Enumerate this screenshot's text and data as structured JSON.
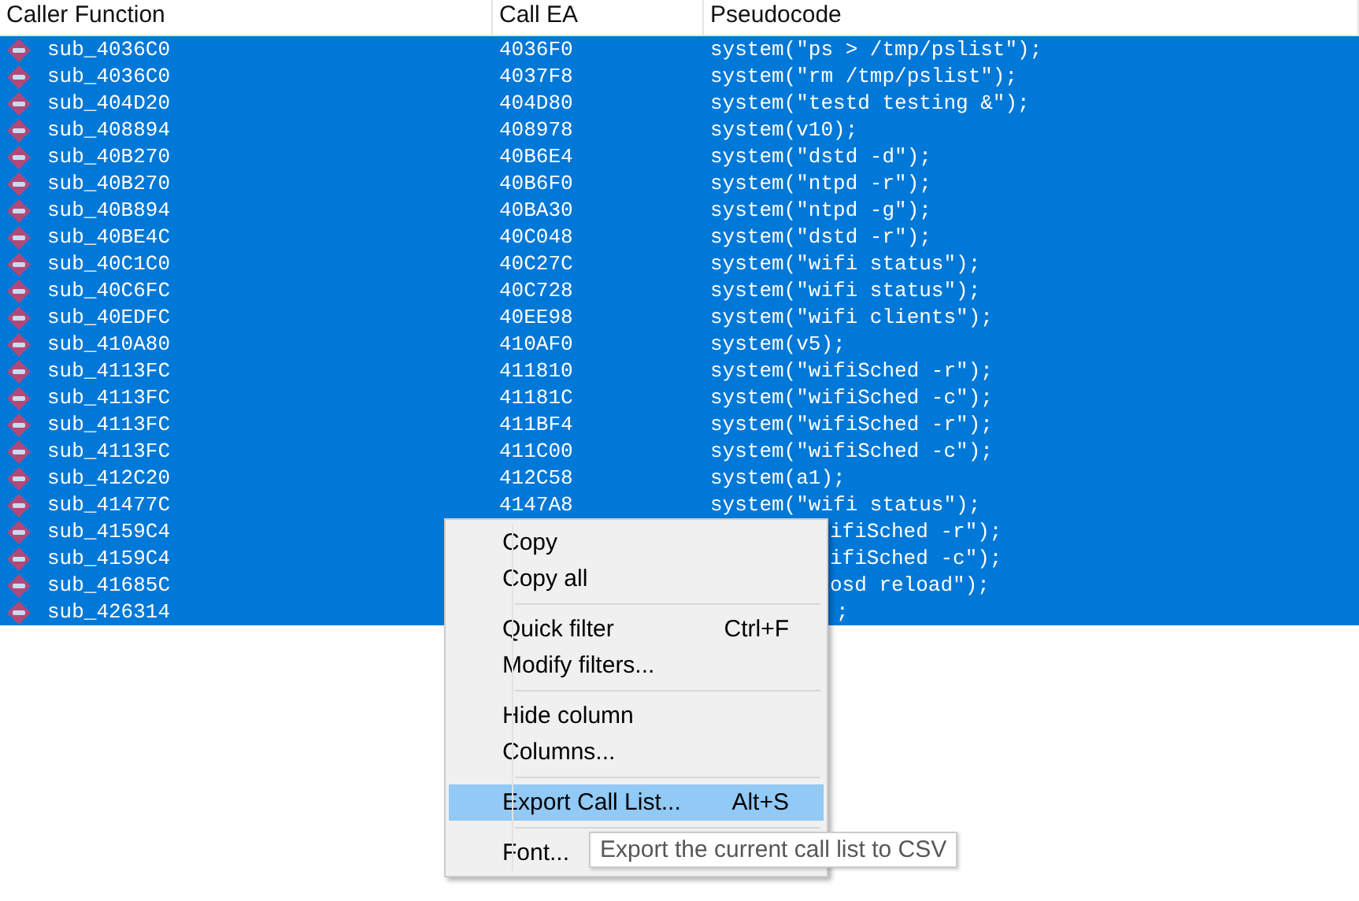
{
  "table": {
    "columns": [
      "Caller Function",
      "Call EA",
      "Pseudocode"
    ],
    "rows": [
      {
        "caller": "sub_4036C0",
        "ea": "4036F0",
        "pseudocode": "system(\"ps > /tmp/pslist\");",
        "selected": true
      },
      {
        "caller": "sub_4036C0",
        "ea": "4037F8",
        "pseudocode": "system(\"rm /tmp/pslist\");",
        "selected": true
      },
      {
        "caller": "sub_404D20",
        "ea": "404D80",
        "pseudocode": "system(\"testd testing &\");",
        "selected": true
      },
      {
        "caller": "sub_408894",
        "ea": "408978",
        "pseudocode": "system(v10);",
        "selected": true
      },
      {
        "caller": "sub_40B270",
        "ea": "40B6E4",
        "pseudocode": "system(\"dstd -d\");",
        "selected": true
      },
      {
        "caller": "sub_40B270",
        "ea": "40B6F0",
        "pseudocode": "system(\"ntpd -r\");",
        "selected": true
      },
      {
        "caller": "sub_40B894",
        "ea": "40BA30",
        "pseudocode": "system(\"ntpd -g\");",
        "selected": true
      },
      {
        "caller": "sub_40BE4C",
        "ea": "40C048",
        "pseudocode": "system(\"dstd -r\");",
        "selected": true
      },
      {
        "caller": "sub_40C1C0",
        "ea": "40C27C",
        "pseudocode": "system(\"wifi status\");",
        "selected": true
      },
      {
        "caller": "sub_40C6FC",
        "ea": "40C728",
        "pseudocode": "system(\"wifi status\");",
        "selected": true
      },
      {
        "caller": "sub_40EDFC",
        "ea": "40EE98",
        "pseudocode": "system(\"wifi clients\");",
        "selected": true
      },
      {
        "caller": "sub_410A80",
        "ea": "410AF0",
        "pseudocode": "system(v5);",
        "selected": true
      },
      {
        "caller": "sub_4113FC",
        "ea": "411810",
        "pseudocode": "system(\"wifiSched -r\");",
        "selected": true
      },
      {
        "caller": "sub_4113FC",
        "ea": "41181C",
        "pseudocode": "system(\"wifiSched -c\");",
        "selected": true
      },
      {
        "caller": "sub_4113FC",
        "ea": "411BF4",
        "pseudocode": "system(\"wifiSched -r\");",
        "selected": true
      },
      {
        "caller": "sub_4113FC",
        "ea": "411C00",
        "pseudocode": "system(\"wifiSched -c\");",
        "selected": true
      },
      {
        "caller": "sub_412C20",
        "ea": "412C58",
        "pseudocode": "system(a1);",
        "selected": true
      },
      {
        "caller": "sub_41477C",
        "ea": "4147A8",
        "pseudocode": "system(\"wifi status\");",
        "selected": true
      },
      {
        "caller": "sub_4159C4",
        "pseudocode": "ifiSched -r\");",
        "kind": "covered",
        "selected": true
      },
      {
        "caller": "sub_4159C4",
        "pseudocode": "ifiSched -c\");",
        "kind": "covered",
        "selected": true
      },
      {
        "caller": "sub_41685C",
        "pseudocode": "osd reload\");",
        "kind": "covered",
        "selected": true
      },
      {
        "caller": "sub_426314",
        "pseudocode": ";",
        "kind": "covered_end",
        "selected": true
      }
    ]
  },
  "context_menu": {
    "items": [
      {
        "kind": "item",
        "label": "Copy",
        "selected": false
      },
      {
        "kind": "item",
        "label": "Copy all",
        "selected": false
      },
      {
        "kind": "separator"
      },
      {
        "kind": "item",
        "label": "Quick filter",
        "shortcut": "Ctrl+F",
        "selected": false
      },
      {
        "kind": "item",
        "label": "Modify filters...",
        "selected": false
      },
      {
        "kind": "separator"
      },
      {
        "kind": "item",
        "label": "Hide column",
        "selected": false
      },
      {
        "kind": "item",
        "label": "Columns...",
        "selected": false
      },
      {
        "kind": "separator"
      },
      {
        "kind": "item",
        "label": "Export Call List...",
        "shortcut": "Alt+S",
        "selected": true
      },
      {
        "kind": "separator"
      },
      {
        "kind": "item",
        "label": "Font...",
        "selected": false
      }
    ]
  },
  "tooltip": "Export the current call list to CSV"
}
